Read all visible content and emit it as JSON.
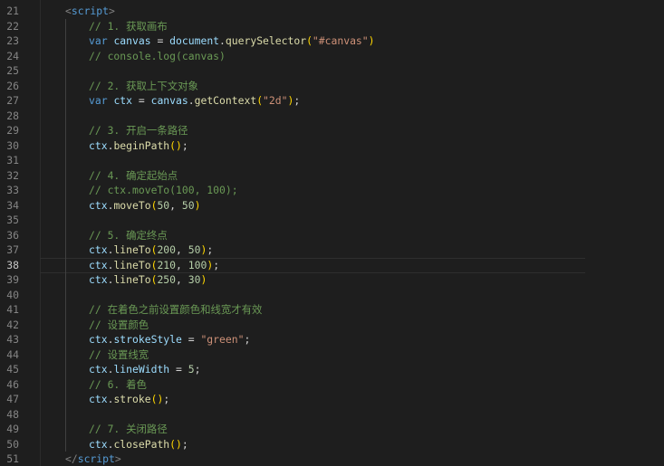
{
  "editor": {
    "active_line": 38,
    "lines": [
      {
        "n": "21",
        "indent": 1,
        "tokens": [
          [
            "brk",
            "<"
          ],
          [
            "tag",
            "script"
          ],
          [
            "brk",
            ">"
          ]
        ]
      },
      {
        "n": "22",
        "indent": 2,
        "tokens": [
          [
            "cmt",
            "// 1. 获取画布"
          ]
        ]
      },
      {
        "n": "23",
        "indent": 2,
        "tokens": [
          [
            "kw",
            "var"
          ],
          [
            "op",
            " "
          ],
          [
            "var",
            "canvas"
          ],
          [
            "op",
            " = "
          ],
          [
            "var",
            "document"
          ],
          [
            "op",
            "."
          ],
          [
            "fn",
            "querySelector"
          ],
          [
            "paren",
            "("
          ],
          [
            "str",
            "\"#canvas\""
          ],
          [
            "paren",
            ")"
          ]
        ]
      },
      {
        "n": "24",
        "indent": 2,
        "tokens": [
          [
            "cmt",
            "// console.log(canvas)"
          ]
        ]
      },
      {
        "n": "25",
        "indent": 2,
        "tokens": []
      },
      {
        "n": "26",
        "indent": 2,
        "tokens": [
          [
            "cmt",
            "// 2. 获取上下文对象"
          ]
        ]
      },
      {
        "n": "27",
        "indent": 2,
        "tokens": [
          [
            "kw",
            "var"
          ],
          [
            "op",
            " "
          ],
          [
            "var",
            "ctx"
          ],
          [
            "op",
            " = "
          ],
          [
            "var",
            "canvas"
          ],
          [
            "op",
            "."
          ],
          [
            "fn",
            "getContext"
          ],
          [
            "paren",
            "("
          ],
          [
            "str",
            "\"2d\""
          ],
          [
            "paren",
            ")"
          ],
          [
            "punc",
            ";"
          ]
        ]
      },
      {
        "n": "28",
        "indent": 2,
        "tokens": []
      },
      {
        "n": "29",
        "indent": 2,
        "tokens": [
          [
            "cmt",
            "// 3. 开启一条路径"
          ]
        ]
      },
      {
        "n": "30",
        "indent": 2,
        "tokens": [
          [
            "var",
            "ctx"
          ],
          [
            "op",
            "."
          ],
          [
            "fn",
            "beginPath"
          ],
          [
            "paren",
            "()"
          ],
          [
            "punc",
            ";"
          ]
        ]
      },
      {
        "n": "31",
        "indent": 2,
        "tokens": []
      },
      {
        "n": "32",
        "indent": 2,
        "tokens": [
          [
            "cmt",
            "// 4. 确定起始点"
          ]
        ]
      },
      {
        "n": "33",
        "indent": 2,
        "tokens": [
          [
            "cmt",
            "// ctx.moveTo(100, 100);"
          ]
        ]
      },
      {
        "n": "34",
        "indent": 2,
        "tokens": [
          [
            "var",
            "ctx"
          ],
          [
            "op",
            "."
          ],
          [
            "fn",
            "moveTo"
          ],
          [
            "paren",
            "("
          ],
          [
            "num",
            "50"
          ],
          [
            "op",
            ", "
          ],
          [
            "num",
            "50"
          ],
          [
            "paren",
            ")"
          ]
        ]
      },
      {
        "n": "35",
        "indent": 2,
        "tokens": []
      },
      {
        "n": "36",
        "indent": 2,
        "tokens": [
          [
            "cmt",
            "// 5. 确定终点"
          ]
        ]
      },
      {
        "n": "37",
        "indent": 2,
        "tokens": [
          [
            "var",
            "ctx"
          ],
          [
            "op",
            "."
          ],
          [
            "fn",
            "lineTo"
          ],
          [
            "paren",
            "("
          ],
          [
            "num",
            "200"
          ],
          [
            "op",
            ", "
          ],
          [
            "num",
            "50"
          ],
          [
            "paren",
            ")"
          ],
          [
            "punc",
            ";"
          ]
        ]
      },
      {
        "n": "38",
        "indent": 2,
        "tokens": [
          [
            "var",
            "ctx"
          ],
          [
            "op",
            "."
          ],
          [
            "fn",
            "lineTo"
          ],
          [
            "paren",
            "("
          ],
          [
            "num",
            "210"
          ],
          [
            "op",
            ", "
          ],
          [
            "num",
            "100"
          ],
          [
            "paren",
            ")"
          ],
          [
            "punc",
            ";"
          ]
        ]
      },
      {
        "n": "39",
        "indent": 2,
        "tokens": [
          [
            "var",
            "ctx"
          ],
          [
            "op",
            "."
          ],
          [
            "fn",
            "lineTo"
          ],
          [
            "paren",
            "("
          ],
          [
            "num",
            "250"
          ],
          [
            "op",
            ", "
          ],
          [
            "num",
            "30"
          ],
          [
            "paren",
            ")"
          ]
        ]
      },
      {
        "n": "40",
        "indent": 2,
        "tokens": []
      },
      {
        "n": "41",
        "indent": 2,
        "tokens": [
          [
            "cmt",
            "// 在着色之前设置颜色和线宽才有效"
          ]
        ]
      },
      {
        "n": "42",
        "indent": 2,
        "tokens": [
          [
            "cmt",
            "// 设置颜色"
          ]
        ]
      },
      {
        "n": "43",
        "indent": 2,
        "tokens": [
          [
            "var",
            "ctx"
          ],
          [
            "op",
            "."
          ],
          [
            "var",
            "strokeStyle"
          ],
          [
            "op",
            " = "
          ],
          [
            "str",
            "\"green\""
          ],
          [
            "punc",
            ";"
          ]
        ]
      },
      {
        "n": "44",
        "indent": 2,
        "tokens": [
          [
            "cmt",
            "// 设置线宽"
          ]
        ]
      },
      {
        "n": "45",
        "indent": 2,
        "tokens": [
          [
            "var",
            "ctx"
          ],
          [
            "op",
            "."
          ],
          [
            "var",
            "lineWidth"
          ],
          [
            "op",
            " = "
          ],
          [
            "num",
            "5"
          ],
          [
            "punc",
            ";"
          ]
        ]
      },
      {
        "n": "46",
        "indent": 2,
        "tokens": [
          [
            "cmt",
            "// 6. 着色"
          ]
        ]
      },
      {
        "n": "47",
        "indent": 2,
        "tokens": [
          [
            "var",
            "ctx"
          ],
          [
            "op",
            "."
          ],
          [
            "fn",
            "stroke"
          ],
          [
            "paren",
            "()"
          ],
          [
            "punc",
            ";"
          ]
        ]
      },
      {
        "n": "48",
        "indent": 2,
        "tokens": []
      },
      {
        "n": "49",
        "indent": 2,
        "tokens": [
          [
            "cmt",
            "// 7. 关闭路径"
          ]
        ]
      },
      {
        "n": "50",
        "indent": 2,
        "tokens": [
          [
            "var",
            "ctx"
          ],
          [
            "op",
            "."
          ],
          [
            "fn",
            "closePath"
          ],
          [
            "paren",
            "()"
          ],
          [
            "punc",
            ";"
          ]
        ]
      },
      {
        "n": "51",
        "indent": 1,
        "tokens": [
          [
            "brk",
            "</"
          ],
          [
            "tag",
            "script"
          ],
          [
            "brk",
            ">"
          ]
        ]
      }
    ]
  },
  "colors": {
    "background": "#1e1e1e",
    "comment": "#6a9955",
    "keyword": "#569cd6",
    "variable": "#9cdcfe",
    "function": "#dcdcaa",
    "string": "#ce9178",
    "number": "#b5cea8",
    "bracket": "#ffd700",
    "line_number": "#858585"
  }
}
